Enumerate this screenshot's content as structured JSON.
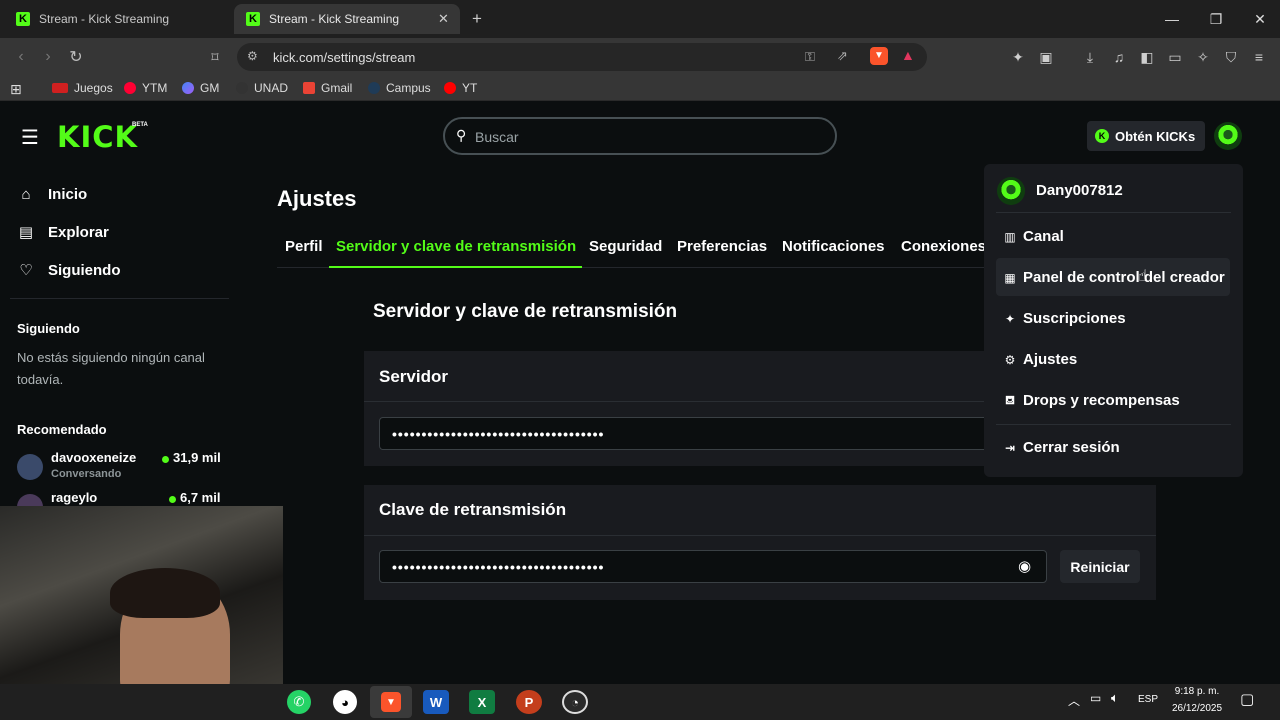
{
  "browser": {
    "tabs": [
      {
        "title": "Stream - Kick Streaming"
      },
      {
        "title": "Stream - Kick Streaming"
      }
    ],
    "new_tab_glyph": "+",
    "url": "kick.com/settings/stream",
    "bookmarks": [
      "Juegos",
      "YTM",
      "GM",
      "UNAD",
      "Gmail",
      "Campus",
      "YT"
    ]
  },
  "kick": {
    "logo": "KICK",
    "beta": "BETA",
    "search_placeholder": "Buscar",
    "get_kicks": "Obtén KICKs",
    "sidebar": {
      "nav": [
        "Inicio",
        "Explorar",
        "Siguiendo"
      ],
      "following_title": "Siguiendo",
      "following_empty": "No estás siguiendo ningún canal todavía.",
      "recommended_title": "Recomendado",
      "recommended": [
        {
          "name": "davooxeneize",
          "category": "Conversando",
          "viewers": "31,9 mil"
        },
        {
          "name": "rageylo",
          "category": "",
          "viewers": "6,7 mil"
        }
      ]
    },
    "settings": {
      "title": "Ajustes",
      "tabs": [
        "Perfil",
        "Servidor y clave de retransmisión",
        "Seguridad",
        "Preferencias",
        "Notificaciones",
        "Conexiones"
      ],
      "active_tab": "Servidor y clave de retransmisión",
      "section_title": "Servidor y clave de retransmisión",
      "server_label": "Servidor",
      "server_value": "••••••••••••••••••••••••••••••••••••",
      "key_label": "Clave de retransmisión",
      "key_value": "••••••••••••••••••••••••••••••••••••",
      "reset_label": "Reiniciar"
    },
    "user_menu": {
      "username": "Dany007812",
      "items": [
        "Canal",
        "Panel de control del creador",
        "Suscripciones",
        "Ajustes",
        "Drops y recompensas"
      ],
      "logout": "Cerrar sesión"
    }
  },
  "taskbar": {
    "lang": "ESP",
    "time": "9:18 p. m.",
    "date": "26/12/2025"
  },
  "colors": {
    "accent": "#53fc18",
    "bg": "#0b0e0f",
    "panel": "#191b1f"
  }
}
